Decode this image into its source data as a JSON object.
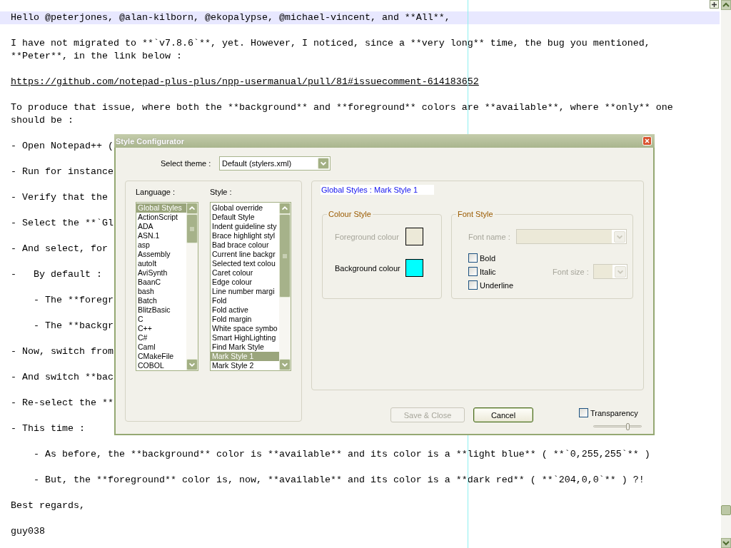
{
  "editor": {
    "paragraphs": [
      {
        "kind": "text",
        "current_line": true,
        "lines": [
          "Hello @peterjones, @alan-kilborn, @ekopalypse, @michael-vincent, and **All**,"
        ]
      },
      {
        "kind": "text",
        "current_line": false,
        "lines": [
          "I have not migrated to **`v7.8.6`**, yet. However, I noticed, since a **very long** time, the bug you mentioned,",
          "**Peter**, in the link below :"
        ]
      },
      {
        "kind": "link",
        "current_line": false,
        "lines": [
          "https://github.com/notepad-plus-plus/npp-usermanual/pull/81#issuecomment-614183652"
        ]
      },
      {
        "kind": "text",
        "current_line": false,
        "lines": [
          "To produce that issue, where both the **background** and **foreground** colors are **available**, where **only** one",
          "should be :"
        ]
      },
      {
        "kind": "text",
        "current_line": false,
        "lines": [
          "- Open Notepad++ ("
        ]
      },
      {
        "kind": "text",
        "current_line": false,
        "lines": [
          "- Run for instance"
        ]
      },
      {
        "kind": "text",
        "current_line": false,
        "lines": [
          "- Verify that the"
        ]
      },
      {
        "kind": "text",
        "current_line": false,
        "lines": [
          "- Select the **`Gl"
        ]
      },
      {
        "kind": "text",
        "current_line": false,
        "lines": [
          "- And select, for"
        ]
      },
      {
        "kind": "text",
        "current_line": false,
        "lines": [
          "-   By default :"
        ]
      },
      {
        "kind": "text",
        "current_line": false,
        "lines": [
          "    - The **foregr"
        ]
      },
      {
        "kind": "text",
        "current_line": false,
        "lines": [
          "    - The **backgr"
        ]
      },
      {
        "kind": "text",
        "current_line": false,
        "lines": [
          "- Now, switch from"
        ]
      },
      {
        "kind": "text",
        "current_line": false,
        "lines": [
          "- And switch **bac"
        ]
      },
      {
        "kind": "text",
        "current_line": false,
        "lines": [
          "- Re-select the **"
        ]
      },
      {
        "kind": "text",
        "current_line": false,
        "lines": [
          "- This time :"
        ]
      },
      {
        "kind": "text",
        "current_line": false,
        "lines": [
          "    - As before, the **background** color is **available** and its color is a **light blue** ( **`0,255,255`** )"
        ]
      },
      {
        "kind": "text",
        "current_line": false,
        "lines": [
          "    - But, the **foreground** color is, now, **available** and its color is a **dark red** ( **`204,0,0`** ) ?!"
        ]
      },
      {
        "kind": "text",
        "current_line": false,
        "lines": [
          "Best regards,"
        ]
      },
      {
        "kind": "text",
        "current_line": false,
        "lines": [
          "guy038"
        ]
      }
    ]
  },
  "dialog": {
    "title": "Style Configurator",
    "theme": {
      "label": "Select theme :",
      "value": "Default (stylers.xml)"
    },
    "language": {
      "label": "Language :",
      "items": [
        {
          "text": "Global Styles",
          "selected": true
        },
        {
          "text": "ActionScript",
          "selected": false
        },
        {
          "text": "ADA",
          "selected": false
        },
        {
          "text": "ASN.1",
          "selected": false
        },
        {
          "text": "asp",
          "selected": false
        },
        {
          "text": "Assembly",
          "selected": false
        },
        {
          "text": "autoIt",
          "selected": false
        },
        {
          "text": "AviSynth",
          "selected": false
        },
        {
          "text": "BaanC",
          "selected": false
        },
        {
          "text": "bash",
          "selected": false
        },
        {
          "text": "Batch",
          "selected": false
        },
        {
          "text": "BlitzBasic",
          "selected": false
        },
        {
          "text": "C",
          "selected": false
        },
        {
          "text": "C++",
          "selected": false
        },
        {
          "text": "C#",
          "selected": false
        },
        {
          "text": "Caml",
          "selected": false
        },
        {
          "text": "CMakeFile",
          "selected": false
        },
        {
          "text": "COBOL",
          "selected": false
        }
      ]
    },
    "style": {
      "label": "Style :",
      "items": [
        {
          "text": "Global override",
          "selected": false
        },
        {
          "text": "Default Style",
          "selected": false
        },
        {
          "text": "Indent guideline sty",
          "selected": false
        },
        {
          "text": "Brace highlight styl",
          "selected": false
        },
        {
          "text": "Bad brace colour",
          "selected": false
        },
        {
          "text": "Current line backgr",
          "selected": false
        },
        {
          "text": "Selected text colou",
          "selected": false
        },
        {
          "text": "Caret colour",
          "selected": false
        },
        {
          "text": "Edge colour",
          "selected": false
        },
        {
          "text": "Line number margi",
          "selected": false
        },
        {
          "text": "Fold",
          "selected": false
        },
        {
          "text": "Fold active",
          "selected": false
        },
        {
          "text": "Fold margin",
          "selected": false
        },
        {
          "text": "White space symbo",
          "selected": false
        },
        {
          "text": "Smart HighLighting",
          "selected": false
        },
        {
          "text": "Find Mark Style",
          "selected": false
        },
        {
          "text": "Mark Style 1",
          "selected": true
        },
        {
          "text": "Mark Style 2",
          "selected": false
        }
      ]
    },
    "style_title": "Global Styles : Mark Style 1",
    "colour_style": {
      "title": "Colour Style",
      "items": [
        {
          "label": "Foreground colour",
          "disabled": true,
          "color": "#ece9d8"
        },
        {
          "label": "Background colour",
          "disabled": false,
          "color": "#00ffff"
        }
      ]
    },
    "font_style": {
      "title": "Font Style",
      "font_name": {
        "label": "Font name :",
        "disabled": true
      },
      "font_size": {
        "label": "Font size :",
        "disabled": true
      },
      "checkboxes": [
        {
          "label": "Bold",
          "checked": false
        },
        {
          "label": "Italic",
          "checked": false
        },
        {
          "label": "Underline",
          "checked": false
        }
      ]
    },
    "buttons": [
      {
        "label": "Save & Close",
        "disabled": true,
        "default": false
      },
      {
        "label": "Cancel",
        "disabled": false,
        "default": true
      }
    ],
    "transparency": {
      "label": "Transparency",
      "checked": false,
      "level": 0.72
    }
  }
}
